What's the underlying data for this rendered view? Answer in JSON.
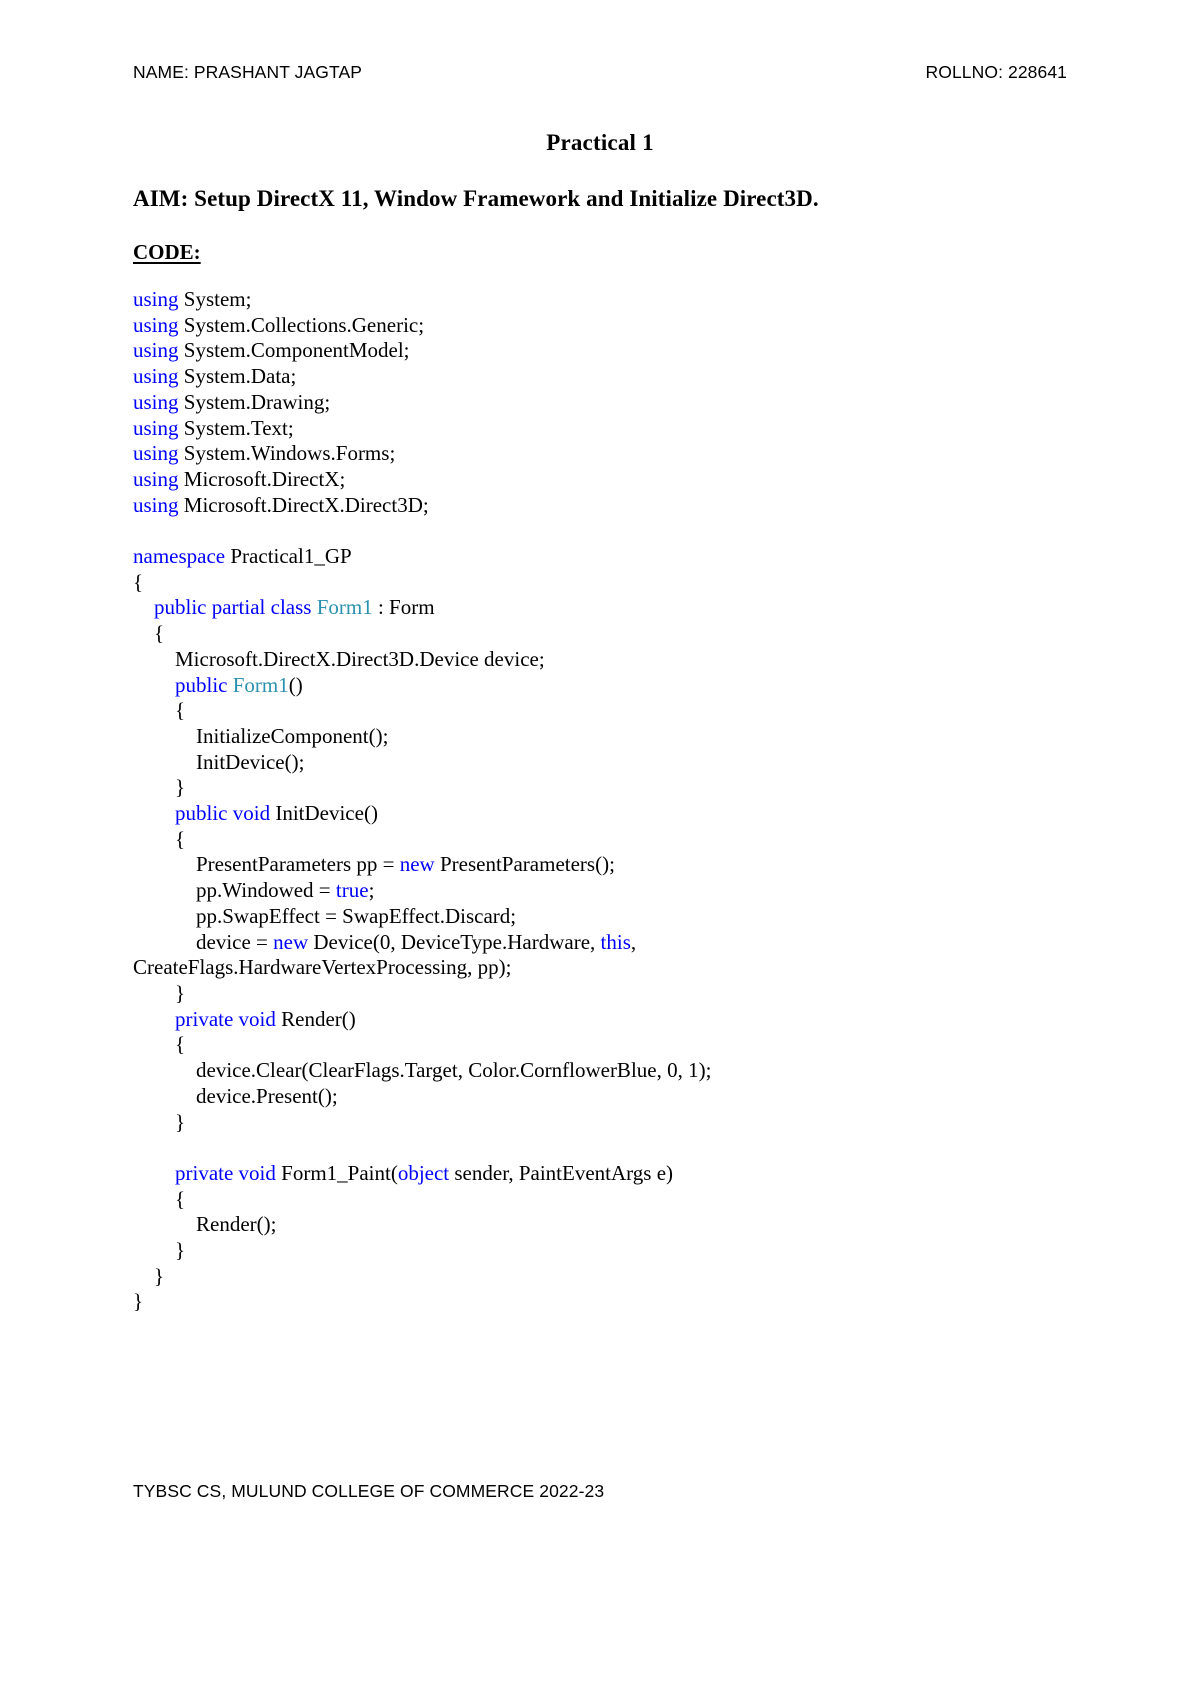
{
  "document": {
    "header": {
      "name_label": "NAME: PRASHANT JAGTAP",
      "rollno_label": "ROLLNO: 228641"
    },
    "footer": {
      "text": "TYBSC CS, MULUND COLLEGE OF COMMERCE 2022-23"
    },
    "title": "Practical 1",
    "aim": "AIM: Setup DirectX 11, Window Framework and Initialize Direct3D.",
    "code_label": "CODE:",
    "colors": {
      "keyword": "#0000FF",
      "type": "#2B91AF",
      "text": "#000000",
      "background": "#FFFFFF"
    },
    "code": [
      {
        "tokens": [
          {
            "t": "using",
            "c": "kw"
          },
          {
            "t": " System;",
            "c": ""
          }
        ]
      },
      {
        "tokens": [
          {
            "t": "using",
            "c": "kw"
          },
          {
            "t": " System.Collections.Generic;",
            "c": ""
          }
        ]
      },
      {
        "tokens": [
          {
            "t": "using",
            "c": "kw"
          },
          {
            "t": " System.ComponentModel;",
            "c": ""
          }
        ]
      },
      {
        "tokens": [
          {
            "t": "using",
            "c": "kw"
          },
          {
            "t": " System.Data;",
            "c": ""
          }
        ]
      },
      {
        "tokens": [
          {
            "t": "using",
            "c": "kw"
          },
          {
            "t": " System.Drawing;",
            "c": ""
          }
        ]
      },
      {
        "tokens": [
          {
            "t": "using",
            "c": "kw"
          },
          {
            "t": " System.Text;",
            "c": ""
          }
        ]
      },
      {
        "tokens": [
          {
            "t": "using",
            "c": "kw"
          },
          {
            "t": " System.Windows.Forms;",
            "c": ""
          }
        ]
      },
      {
        "tokens": [
          {
            "t": "using",
            "c": "kw"
          },
          {
            "t": " Microsoft.DirectX;",
            "c": ""
          }
        ]
      },
      {
        "tokens": [
          {
            "t": "using",
            "c": "kw"
          },
          {
            "t": " Microsoft.DirectX.Direct3D;",
            "c": ""
          }
        ]
      },
      {
        "tokens": [
          {
            "t": "",
            "c": ""
          }
        ]
      },
      {
        "tokens": [
          {
            "t": "namespace",
            "c": "kw"
          },
          {
            "t": " Practical1_GP",
            "c": ""
          }
        ]
      },
      {
        "tokens": [
          {
            "t": "{",
            "c": ""
          }
        ]
      },
      {
        "tokens": [
          {
            "t": "    ",
            "c": ""
          },
          {
            "t": "public partial class",
            "c": "kw"
          },
          {
            "t": " ",
            "c": ""
          },
          {
            "t": "Form1",
            "c": "typ"
          },
          {
            "t": " : Form",
            "c": ""
          }
        ]
      },
      {
        "tokens": [
          {
            "t": "    {",
            "c": ""
          }
        ]
      },
      {
        "tokens": [
          {
            "t": "        Microsoft.DirectX.Direct3D.Device device;",
            "c": ""
          }
        ]
      },
      {
        "tokens": [
          {
            "t": "        ",
            "c": ""
          },
          {
            "t": "public",
            "c": "kw"
          },
          {
            "t": " ",
            "c": ""
          },
          {
            "t": "Form1",
            "c": "typ"
          },
          {
            "t": "()",
            "c": ""
          }
        ]
      },
      {
        "tokens": [
          {
            "t": "        {",
            "c": ""
          }
        ]
      },
      {
        "tokens": [
          {
            "t": "            InitializeComponent();",
            "c": ""
          }
        ]
      },
      {
        "tokens": [
          {
            "t": "            InitDevice();",
            "c": ""
          }
        ]
      },
      {
        "tokens": [
          {
            "t": "        }",
            "c": ""
          }
        ]
      },
      {
        "tokens": [
          {
            "t": "        ",
            "c": ""
          },
          {
            "t": "public void",
            "c": "kw"
          },
          {
            "t": " InitDevice()",
            "c": ""
          }
        ]
      },
      {
        "tokens": [
          {
            "t": "        {",
            "c": ""
          }
        ]
      },
      {
        "tokens": [
          {
            "t": "            PresentParameters pp = ",
            "c": ""
          },
          {
            "t": "new",
            "c": "kw"
          },
          {
            "t": " PresentParameters();",
            "c": ""
          }
        ]
      },
      {
        "tokens": [
          {
            "t": "            pp.Windowed = ",
            "c": ""
          },
          {
            "t": "true",
            "c": "kw"
          },
          {
            "t": ";",
            "c": ""
          }
        ]
      },
      {
        "tokens": [
          {
            "t": "            pp.SwapEffect = SwapEffect.Discard;",
            "c": ""
          }
        ]
      },
      {
        "tokens": [
          {
            "t": "            device = ",
            "c": ""
          },
          {
            "t": "new",
            "c": "kw"
          },
          {
            "t": " Device(0, DeviceType.Hardware, ",
            "c": ""
          },
          {
            "t": "this",
            "c": "kw"
          },
          {
            "t": ",",
            "c": ""
          }
        ]
      },
      {
        "tokens": [
          {
            "t": "CreateFlags.HardwareVertexProcessing, pp);",
            "c": ""
          }
        ]
      },
      {
        "tokens": [
          {
            "t": "        }",
            "c": ""
          }
        ]
      },
      {
        "tokens": [
          {
            "t": "        ",
            "c": ""
          },
          {
            "t": "private void",
            "c": "kw"
          },
          {
            "t": " Render()",
            "c": ""
          }
        ]
      },
      {
        "tokens": [
          {
            "t": "        {",
            "c": ""
          }
        ]
      },
      {
        "tokens": [
          {
            "t": "            device.Clear(ClearFlags.Target, Color.CornflowerBlue, 0, 1);",
            "c": ""
          }
        ]
      },
      {
        "tokens": [
          {
            "t": "            device.Present();",
            "c": ""
          }
        ]
      },
      {
        "tokens": [
          {
            "t": "        }",
            "c": ""
          }
        ]
      },
      {
        "tokens": [
          {
            "t": "",
            "c": ""
          }
        ]
      },
      {
        "tokens": [
          {
            "t": "        ",
            "c": ""
          },
          {
            "t": "private void",
            "c": "kw"
          },
          {
            "t": " Form1_Paint(",
            "c": ""
          },
          {
            "t": "object",
            "c": "kw"
          },
          {
            "t": " sender, PaintEventArgs e)",
            "c": ""
          }
        ]
      },
      {
        "tokens": [
          {
            "t": "        {",
            "c": ""
          }
        ]
      },
      {
        "tokens": [
          {
            "t": "            Render();",
            "c": ""
          }
        ]
      },
      {
        "tokens": [
          {
            "t": "        }",
            "c": ""
          }
        ]
      },
      {
        "tokens": [
          {
            "t": "    }",
            "c": ""
          }
        ]
      },
      {
        "tokens": [
          {
            "t": "}",
            "c": ""
          }
        ]
      }
    ]
  }
}
